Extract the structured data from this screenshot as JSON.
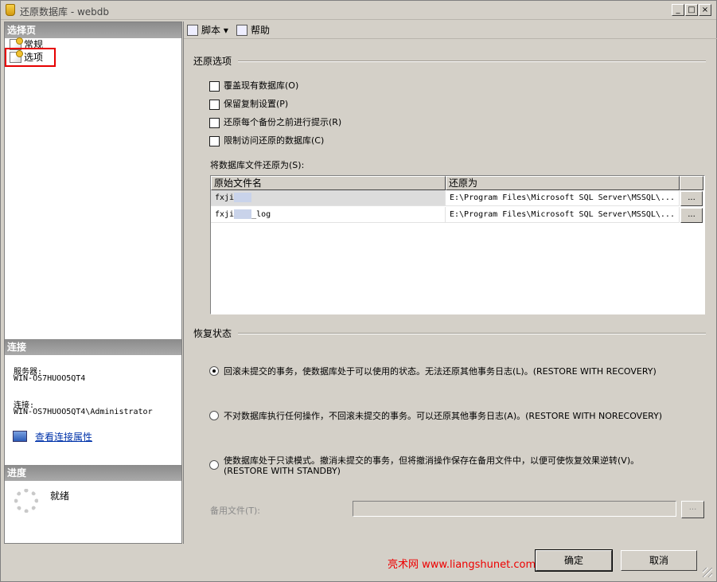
{
  "window": {
    "title": "还原数据库 - webdb",
    "controls": {
      "minimize": "_",
      "maximize": "□",
      "close": "×"
    }
  },
  "left_panel": {
    "select_page_header": "选择页",
    "nav_items": [
      {
        "label": "常规",
        "icon": "page-icon",
        "selected": false
      },
      {
        "label": "选项",
        "icon": "page-icon",
        "selected": true
      }
    ],
    "connection_header": "连接",
    "server_label": "服务器:",
    "server_value": "WIN-OS7HUOO5QT4",
    "connection_label": "连接:",
    "connection_value": "WIN-OS7HUOO5QT4\\Administrator",
    "view_connection_link": "查看连接属性",
    "progress_header": "进度",
    "progress_status": "就绪"
  },
  "toolbar": {
    "script_label": "脚本",
    "script_dropdown": "▾",
    "help_label": "帮助"
  },
  "restore_options": {
    "group_title": "还原选项",
    "checkboxes": [
      {
        "label": "覆盖现有数据库(O)",
        "checked": false
      },
      {
        "label": "保留复制设置(P)",
        "checked": false
      },
      {
        "label": "还原每个备份之前进行提示(R)",
        "checked": false
      },
      {
        "label": "限制访问还原的数据库(C)",
        "checked": false
      }
    ],
    "file_restore_label": "将数据库文件还原为(S):",
    "columns": [
      "原始文件名",
      "还原为"
    ],
    "rows": [
      {
        "original": "fxji",
        "restore_as": "E:\\Program Files\\Microsoft SQL Server\\MSSQL\\...",
        "button": "..."
      },
      {
        "original": "fxji_log",
        "restore_as": "E:\\Program Files\\Microsoft SQL Server\\MSSQL\\...",
        "button": "..."
      }
    ]
  },
  "recovery_state": {
    "group_title": "恢复状态",
    "options": [
      {
        "label": "回滚未提交的事务，使数据库处于可以使用的状态。无法还原其他事务日志(L)。(RESTORE WITH RECOVERY)",
        "selected": true
      },
      {
        "label": "不对数据库执行任何操作，不回滚未提交的事务。可以还原其他事务日志(A)。(RESTORE WITH NORECOVERY)",
        "selected": false
      },
      {
        "label": "使数据库处于只读模式。撤消未提交的事务，但将撤消操作保存在备用文件中，以便可使恢复效果逆转(V)。",
        "label_line2": "(RESTORE WITH STANDBY)",
        "selected": false
      }
    ],
    "standby_file_label": "备用文件(T):",
    "standby_file_value": "",
    "standby_browse": "..."
  },
  "footer": {
    "watermark": "亮术网 www.liangshunet.com",
    "ok_label": "确定",
    "cancel_label": "取消"
  }
}
